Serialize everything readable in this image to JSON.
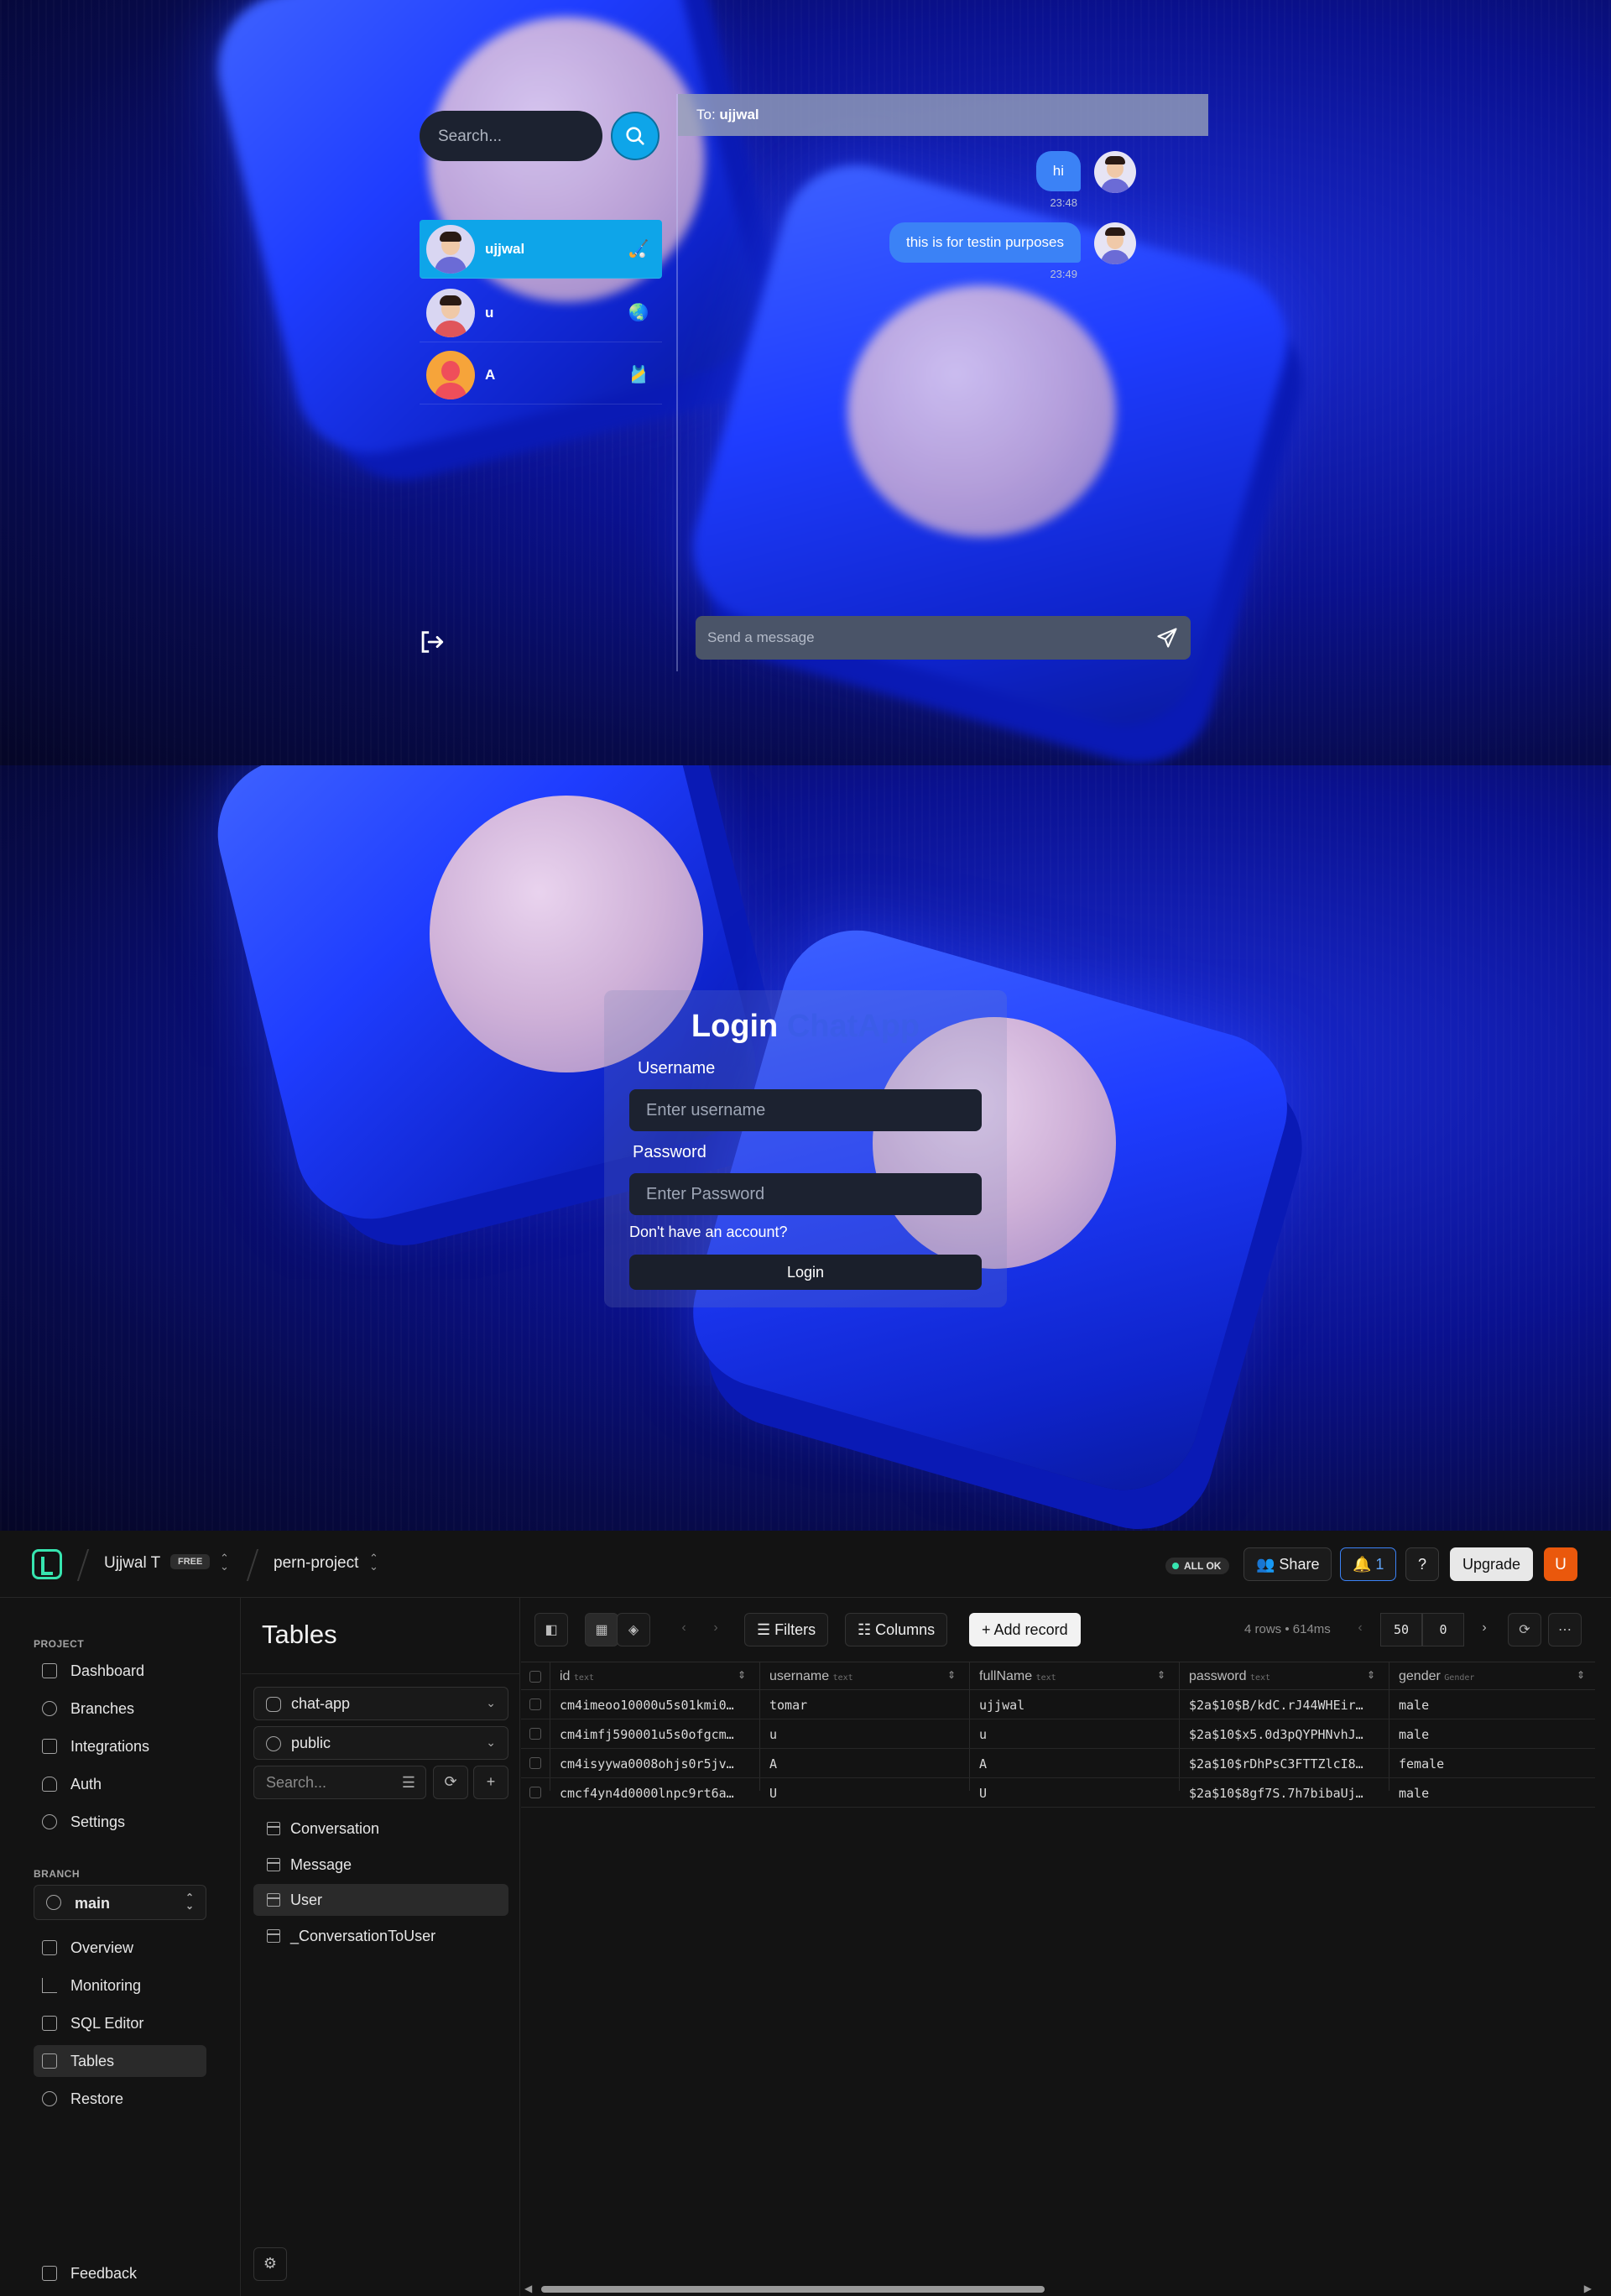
{
  "chat": {
    "search_placeholder": "Search...",
    "contacts": [
      {
        "name": "ujjwal",
        "emoji": "🏑",
        "active": true
      },
      {
        "name": "u",
        "emoji": "🌏",
        "active": false
      },
      {
        "name": "A",
        "emoji": "🎽",
        "active": false
      }
    ],
    "header_prefix": "To:",
    "header_name": "ujjwal",
    "messages": [
      {
        "text": "hi",
        "time": "23:48"
      },
      {
        "text": "this is for testin purposes",
        "time": "23:49"
      }
    ],
    "send_placeholder": "Send a message"
  },
  "login": {
    "title_main": "Login",
    "title_accent": "ChatApp",
    "username_label": "Username",
    "username_placeholder": "Enter username",
    "password_label": "Password",
    "password_placeholder": "Enter Password",
    "signup_link": "Don't have an account?",
    "button": "Login"
  },
  "neon": {
    "org": "Ujjwal T",
    "plan": "FREE",
    "project": "pern-project",
    "status": "ALL OK",
    "share": "Share",
    "notifications": "1",
    "upgrade": "Upgrade",
    "user_initial": "U",
    "section_project": "PROJECT",
    "project_nav": [
      "Dashboard",
      "Branches",
      "Integrations",
      "Auth",
      "Settings"
    ],
    "section_branch": "BRANCH",
    "branch": "main",
    "branch_nav": [
      "Overview",
      "Monitoring",
      "SQL Editor",
      "Tables",
      "Restore"
    ],
    "active_nav": "Tables",
    "feedback": "Feedback",
    "tables_title": "Tables",
    "database": "chat-app",
    "schema": "public",
    "table_search_placeholder": "Search...",
    "tables": [
      "Conversation",
      "Message",
      "User",
      "_ConversationToUser"
    ],
    "active_table": "User",
    "toolbar": {
      "filters": "Filters",
      "columns": "Columns",
      "add_record": "Add record",
      "rows_info": "4 rows • 614ms",
      "limit": "50",
      "offset": "0"
    },
    "columns": [
      {
        "name": "id",
        "type": "text"
      },
      {
        "name": "username",
        "type": "text"
      },
      {
        "name": "fullName",
        "type": "text"
      },
      {
        "name": "password",
        "type": "text"
      },
      {
        "name": "gender",
        "type": "Gender"
      }
    ],
    "rows": [
      [
        "cm4imeoo10000u5s01kmi0…",
        "tomar",
        "ujjwal",
        "$2a$10$B/kdC.rJ44WHEir…",
        "male"
      ],
      [
        "cm4imfj590001u5s0ofgcm…",
        "u",
        "u",
        "$2a$10$x5.0d3pQYPHNvhJ…",
        "male"
      ],
      [
        "cm4isyywa0008ohjs0r5jv…",
        "A",
        "A",
        "$2a$10$rDhPsC3FTTZlcI8…",
        "female"
      ],
      [
        "cmcf4yn4d0000lnpc9rt6a…",
        "U",
        "U",
        "$2a$10$8gf7S.7h7bibaUj…",
        "male"
      ]
    ]
  }
}
